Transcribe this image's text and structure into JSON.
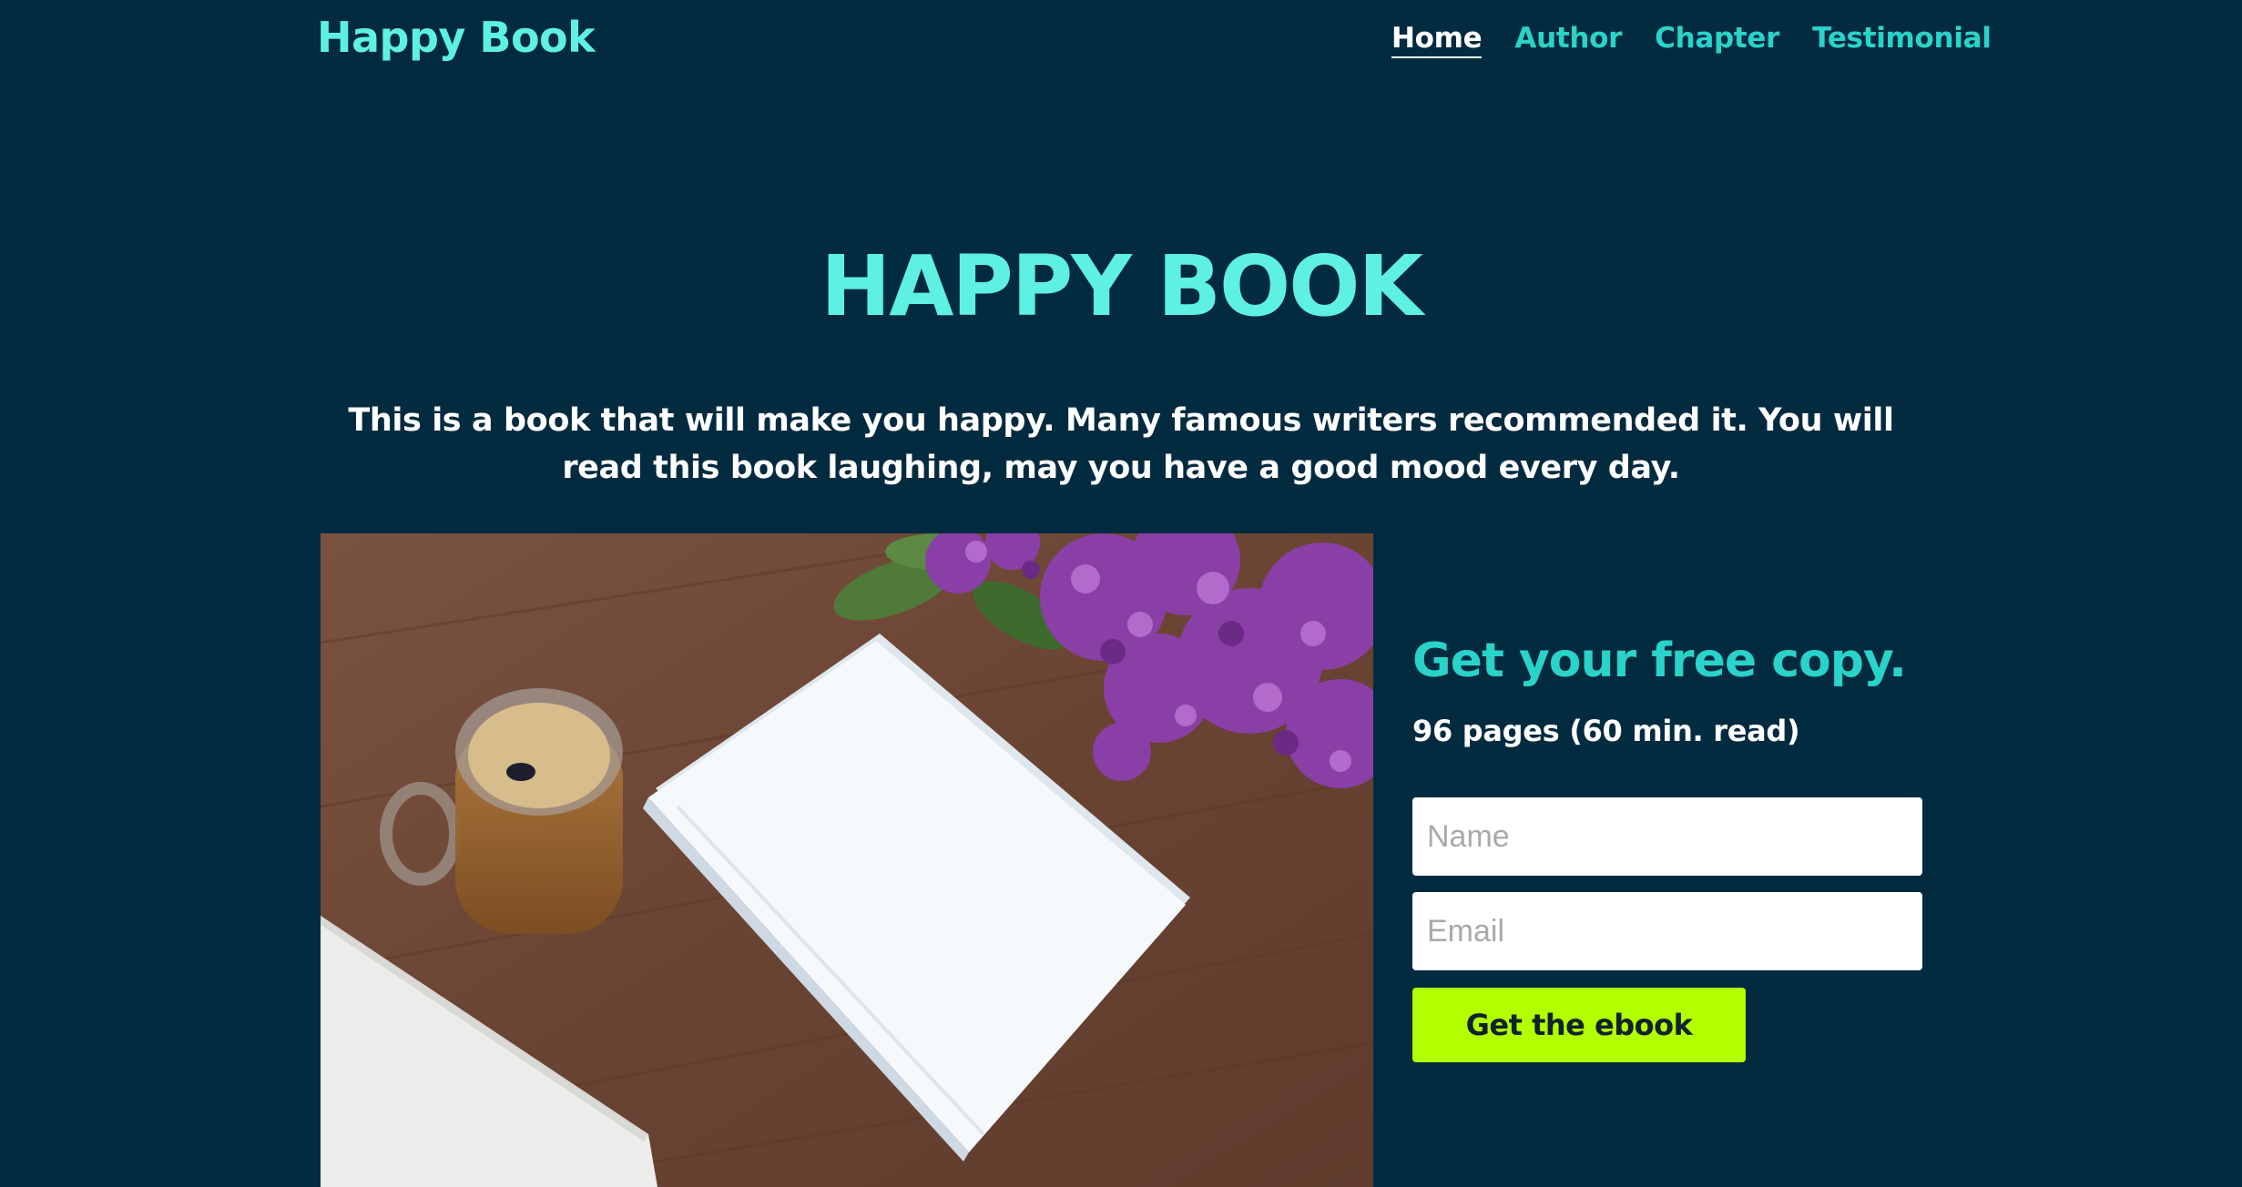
{
  "header": {
    "logo": "Happy Book",
    "nav": [
      {
        "label": "Home",
        "active": true
      },
      {
        "label": "Author",
        "active": false
      },
      {
        "label": "Chapter",
        "active": false
      },
      {
        "label": "Testimonial",
        "active": false
      }
    ]
  },
  "hero": {
    "title": "HAPPY BOOK",
    "description": "This is a book that will make you happy. Many famous writers recommended it. You will read this book laughing, may you have a good mood every day."
  },
  "signup": {
    "title": "Get your free copy.",
    "meta": "96 pages (60 min. read)",
    "name_placeholder": "Name",
    "email_placeholder": "Email",
    "button_label": "Get the ebook"
  },
  "colors": {
    "background": "#032b40",
    "accent": "#5ef0e3",
    "link": "#2ad3c9",
    "cta": "#b2ff00"
  }
}
